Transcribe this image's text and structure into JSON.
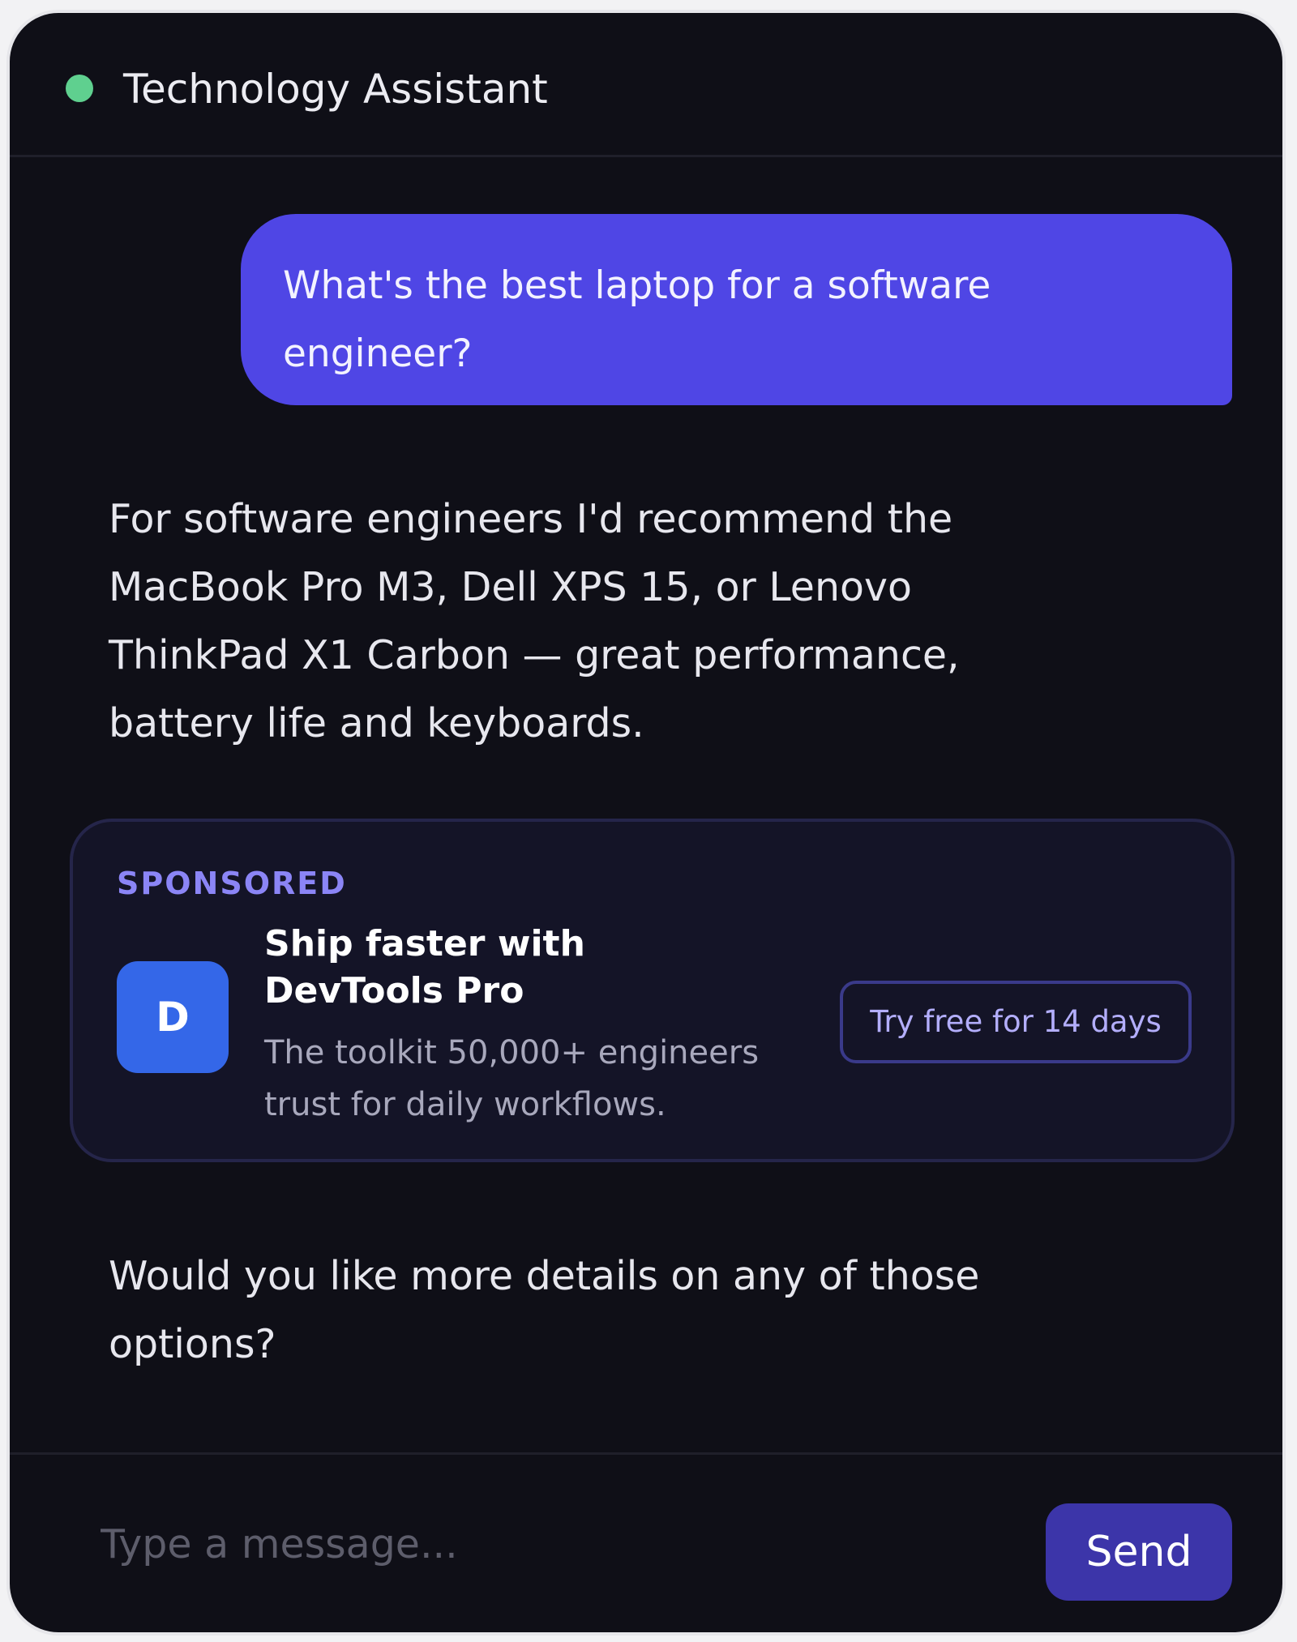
{
  "header": {
    "title": "Technology Assistant",
    "status_color": "#5fd08f"
  },
  "conversation": {
    "user_message": "What's the best laptop for a software engineer?",
    "assistant_reply_1": "For software engineers I'd recommend the MacBook Pro M3, Dell XPS 15, or Lenovo ThinkPad X1 Carbon — great performance, battery life and keyboards.",
    "assistant_reply_2": "Would you like more details on any of those options?"
  },
  "ad": {
    "label": "SPONSORED",
    "logo_letter": "D",
    "headline": "Ship faster with DevTools Pro",
    "body": "The toolkit 50,000+ engineers trust for daily workflows.",
    "cta_label": "Try free for 14 days",
    "logo_color": "#3467e8",
    "accent_color": "#8b85f6"
  },
  "composer": {
    "placeholder": "Type a message...",
    "value": "",
    "send_label": "Send"
  },
  "colors": {
    "background": "#0f0f17",
    "user_bubble": "#4f46e5",
    "send_button": "#3c35a9"
  }
}
